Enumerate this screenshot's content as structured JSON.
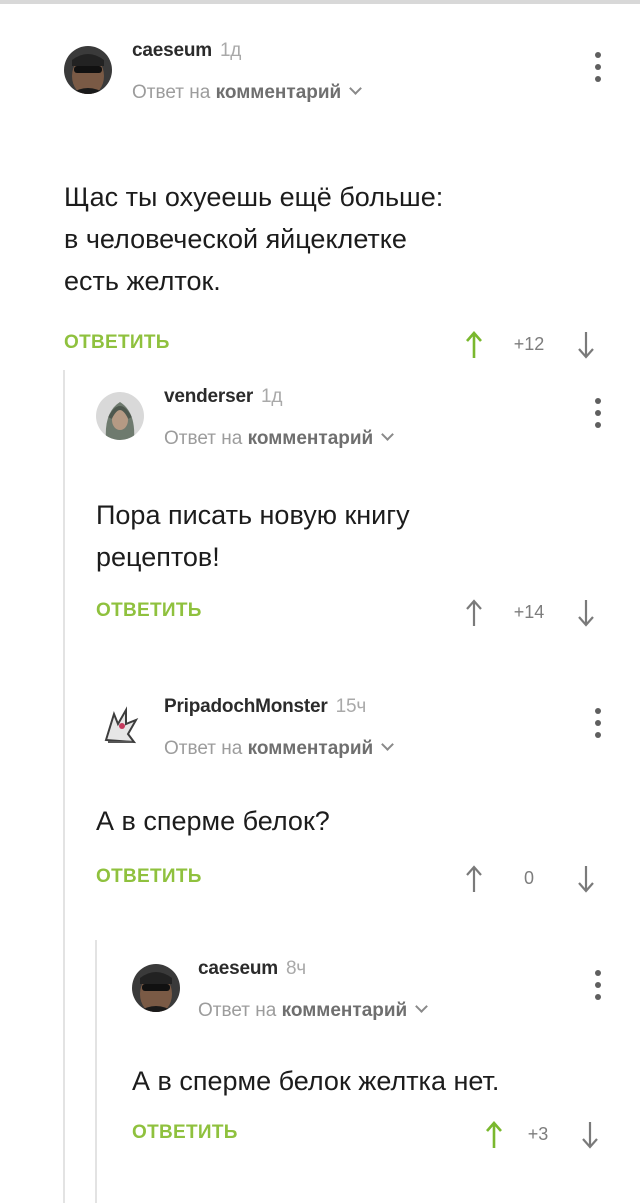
{
  "common": {
    "reply_prefix": "Ответ на",
    "reply_target": "комментарий",
    "reply_action": "ОТВЕТИТЬ"
  },
  "comments": [
    {
      "author": "caeseum",
      "time": "1д",
      "text": [
        "Щас ты охуеешь ещё больше:",
        "в человеческой яйцеклетке",
        "есть желток."
      ],
      "score": "+12"
    },
    {
      "author": "venderser",
      "time": "1д",
      "text": [
        "Пора писать новую книгу",
        "рецептов!"
      ],
      "score": "+14"
    },
    {
      "author": "PripadochMonster",
      "time": "15ч",
      "text": [
        "А в сперме белок?"
      ],
      "score": "0"
    },
    {
      "author": "caeseum",
      "time": "8ч",
      "text": [
        "А в сперме белок желтка нет."
      ],
      "score": "+3"
    }
  ],
  "colors": {
    "reply_green": "#8fc13e",
    "upvote_green": "#7ab82e",
    "downvote_gray": "#7a7a7a"
  },
  "icons": {
    "upvote": "arrow-up-icon",
    "downvote": "arrow-down-icon",
    "menu": "more-vertical-icon"
  }
}
